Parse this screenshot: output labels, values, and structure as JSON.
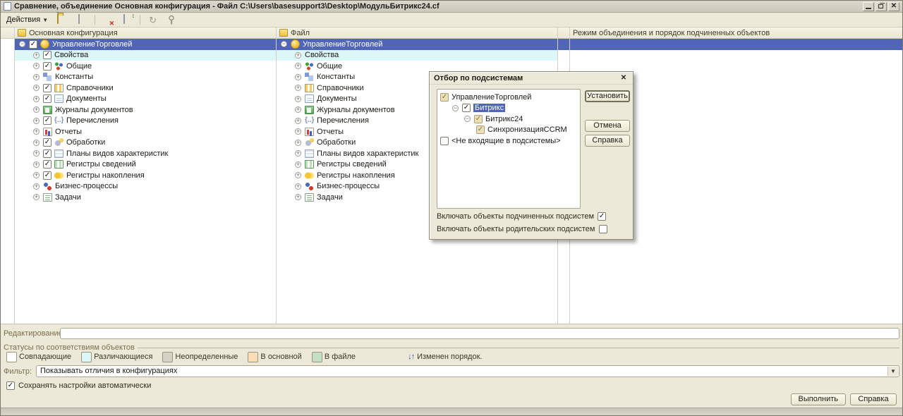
{
  "window": {
    "title": "Сравнение, объединение Основная конфигурация - Файл C:\\Users\\basesupport3\\Desktop\\МодульБитрикс24.cf",
    "controls": [
      "minimize-icon",
      "restore-icon",
      "close-icon"
    ]
  },
  "toolbar": {
    "actions_label": "Действия",
    "icons": [
      "open-file-icon",
      "save-file-icon",
      "subsystem-filter-icon",
      "match-settings-icon",
      "refresh-icon",
      "tools-icon"
    ]
  },
  "columns": {
    "left_header": "Основная конфигурация",
    "file_header": "Файл",
    "mode_header": "Режим объединения и порядок подчиненных объектов"
  },
  "tree": {
    "rows": [
      {
        "label": "УправлениеТорговлей",
        "checked": true,
        "icon": "subsystem-icon",
        "indent": 0,
        "expand": "minus",
        "status": "selected"
      },
      {
        "label": "Свойства",
        "checked": true,
        "icon": null,
        "indent": 1,
        "expand": "plus",
        "status": "different"
      },
      {
        "label": "Общие",
        "checked": true,
        "icon": "common-icon",
        "indent": 1,
        "expand": "plus",
        "status": null
      },
      {
        "label": "Константы",
        "checked": null,
        "icon": "constants-icon",
        "indent": 1,
        "expand": "plus",
        "status": null
      },
      {
        "label": "Справочники",
        "checked": true,
        "icon": "catalogs-icon",
        "indent": 1,
        "expand": "plus",
        "status": null
      },
      {
        "label": "Документы",
        "checked": true,
        "icon": "documents-icon",
        "indent": 1,
        "expand": "plus",
        "status": null
      },
      {
        "label": "Журналы документов",
        "checked": null,
        "icon": "journals-icon",
        "indent": 1,
        "expand": "plus",
        "status": null
      },
      {
        "label": "Перечисления",
        "checked": true,
        "icon": "enums-icon",
        "indent": 1,
        "expand": "plus",
        "status": null
      },
      {
        "label": "Отчеты",
        "checked": null,
        "icon": "reports-icon",
        "indent": 1,
        "expand": "plus",
        "status": null
      },
      {
        "label": "Обработки",
        "checked": true,
        "icon": "dataprocessors-icon",
        "indent": 1,
        "expand": "plus",
        "status": null
      },
      {
        "label": "Планы видов характеристик",
        "checked": true,
        "icon": "chart-types-icon",
        "indent": 1,
        "expand": "plus",
        "status": null
      },
      {
        "label": "Регистры сведений",
        "checked": true,
        "icon": "inforeg-icon",
        "indent": 1,
        "expand": "plus",
        "status": null
      },
      {
        "label": "Регистры накопления",
        "checked": true,
        "icon": "accumreg-icon",
        "indent": 1,
        "expand": "plus",
        "status": null
      },
      {
        "label": "Бизнес-процессы",
        "checked": null,
        "icon": "busproc-icon",
        "indent": 1,
        "expand": "plus",
        "status": null
      },
      {
        "label": "Задачи",
        "checked": null,
        "icon": "tasks-icon",
        "indent": 1,
        "expand": "plus",
        "status": null
      }
    ]
  },
  "dialog": {
    "title": "Отбор по подсистемам",
    "close_icon": "close-icon",
    "rows": [
      {
        "label": "УправлениеТорговлей",
        "check": "tan",
        "indent": 0,
        "expand": null,
        "selected": false
      },
      {
        "label": "Битрикс",
        "check": "checked",
        "indent": 1,
        "expand": "minus",
        "selected": true
      },
      {
        "label": "Битрикс24",
        "check": "tan",
        "indent": 2,
        "expand": "minus",
        "selected": false
      },
      {
        "label": "СинхронизацияCCRM",
        "check": "tan",
        "indent": 3,
        "expand": null,
        "selected": false
      },
      {
        "label": "<Не входящие в подсистемы>",
        "check": "unchecked",
        "indent": 0,
        "expand": null,
        "selected": false
      }
    ],
    "buttons": {
      "set": "Установить",
      "cancel": "Отмена",
      "help": "Справка"
    },
    "options": [
      {
        "label": "Включать объекты подчиненных подсистем",
        "checked": true
      },
      {
        "label": "Включать объекты родительских подсистем",
        "checked": false
      }
    ]
  },
  "footer": {
    "editing_label": "Редактирование:",
    "editing_value": "",
    "statuses_title": "Статусы по соответствиям объектов",
    "legend": [
      {
        "label": "Совпадающие",
        "color": "#ffffff"
      },
      {
        "label": "Различающиеся",
        "color": "#dcf7f7"
      },
      {
        "label": "Неопределенные",
        "color": "#d5d1c5"
      },
      {
        "label": "В основной",
        "color": "#f8ddb5"
      },
      {
        "label": "В файле",
        "color": "#c3e0c3"
      }
    ],
    "order_legend": {
      "label": "Изменен порядок.",
      "icon": "updown-arrows-icon",
      "glyph": "↓↑"
    },
    "filter_label": "Фильтр:",
    "filter_value": "Показывать отличия в конфигурациях",
    "autosave_label": "Сохранять настройки автоматически",
    "autosave_checked": true,
    "run_button": "Выполнить",
    "help_button": "Справка"
  }
}
